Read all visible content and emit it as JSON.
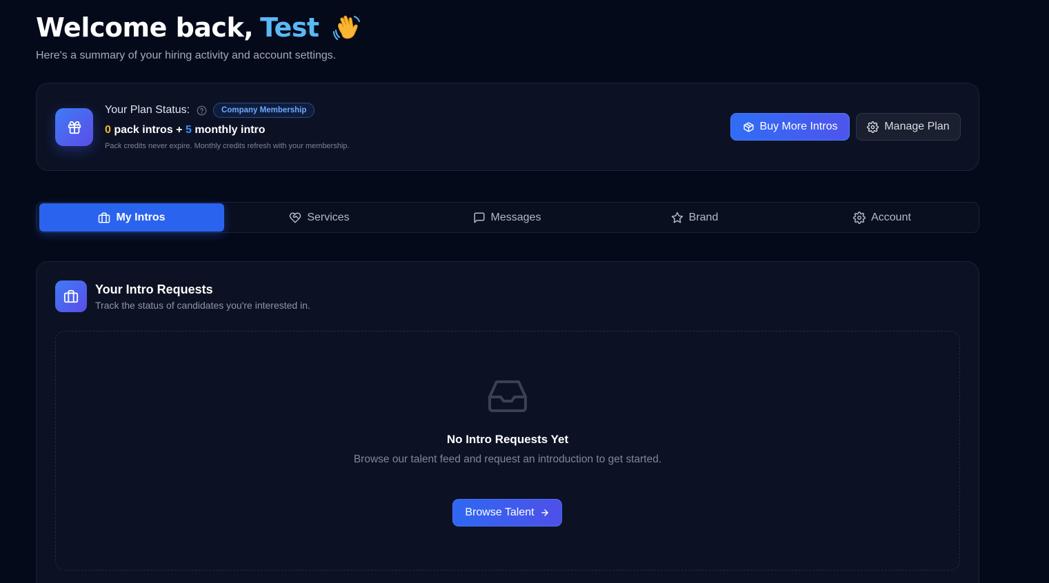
{
  "header": {
    "greeting": "Welcome back,",
    "user_name": "Test",
    "wave_emoji": "👋",
    "subtitle": "Here's a summary of your hiring activity and account settings."
  },
  "plan": {
    "status_label": "Your Plan Status:",
    "badge": "Company Membership",
    "pack_count": "0",
    "pack_label": "pack intros +",
    "monthly_count": "5",
    "monthly_label": "monthly intro",
    "note": "Pack credits never expire. Monthly credits refresh with your membership.",
    "buy_button": "Buy More Intros",
    "manage_button": "Manage Plan",
    "icon": "gift-icon"
  },
  "tabs": [
    {
      "label": "My Intros",
      "icon": "briefcase-icon",
      "active": true
    },
    {
      "label": "Services",
      "icon": "handshake-heart-icon",
      "active": false
    },
    {
      "label": "Messages",
      "icon": "message-icon",
      "active": false
    },
    {
      "label": "Brand",
      "icon": "star-icon",
      "active": false
    },
    {
      "label": "Account",
      "icon": "gear-icon",
      "active": false
    }
  ],
  "requests": {
    "title": "Your Intro Requests",
    "subtitle": "Track the status of candidates you're interested in.",
    "empty_title": "No Intro Requests Yet",
    "empty_text": "Browse our talent feed and request an introduction to get started.",
    "browse_button": "Browse Talent",
    "icon": "briefcase-icon",
    "empty_icon": "inbox-icon"
  },
  "colors": {
    "background": "#050a1a",
    "accent": "#2a63ee",
    "name_highlight": "#5ab8f5",
    "pack_count": "#f5b73a",
    "monthly_count": "#3f8cff"
  }
}
